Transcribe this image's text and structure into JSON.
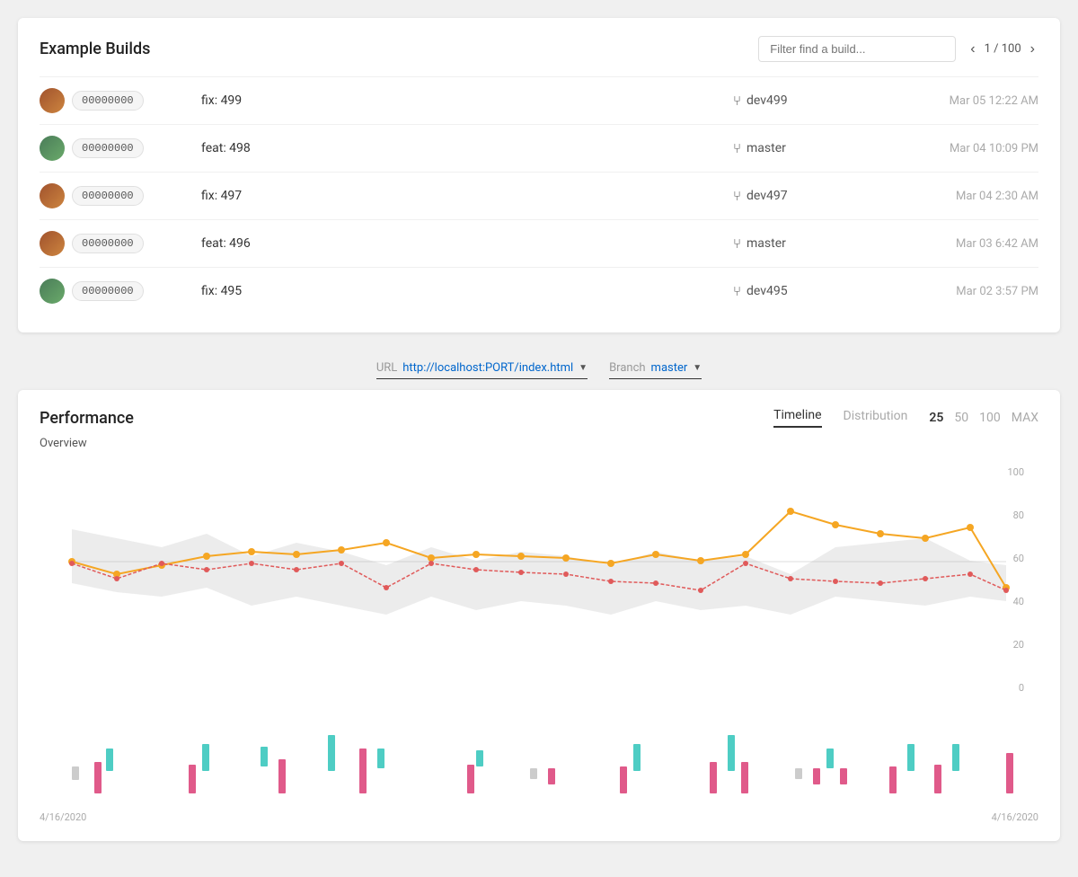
{
  "builds": {
    "title": "Example Builds",
    "filter_placeholder": "Filter find a build...",
    "pagination": {
      "current": "1",
      "total": "100",
      "label": "1 / 100"
    },
    "rows": [
      {
        "id": "00000000",
        "label": "fix: 499",
        "branch": "dev499",
        "date": "Mar 05 12:22 AM",
        "avatar_class": "avatar-1"
      },
      {
        "id": "00000000",
        "label": "feat: 498",
        "branch": "master",
        "date": "Mar 04 10:09 PM",
        "avatar_class": "avatar-2"
      },
      {
        "id": "00000000",
        "label": "fix: 497",
        "branch": "dev497",
        "date": "Mar 04 2:30 AM",
        "avatar_class": "avatar-3"
      },
      {
        "id": "00000000",
        "label": "feat: 496",
        "branch": "master",
        "date": "Mar 03 6:42 AM",
        "avatar_class": "avatar-4"
      },
      {
        "id": "00000000",
        "label": "fix: 495",
        "branch": "dev495",
        "date": "Mar 02 3:57 PM",
        "avatar_class": "avatar-5"
      }
    ]
  },
  "url_bar": {
    "url_label": "URL",
    "url_value": "http://localhost:PORT/index.html",
    "branch_label": "Branch",
    "branch_value": "master"
  },
  "performance": {
    "title": "Performance",
    "tabs": [
      "Timeline",
      "Distribution"
    ],
    "active_tab": "Timeline",
    "counts": [
      "25",
      "50",
      "100",
      "MAX"
    ],
    "active_count": "25",
    "overview_label": "Overview",
    "y_labels": [
      "100",
      "80",
      "60",
      "40",
      "20",
      "0"
    ],
    "date_start": "4/16/2020",
    "date_end": "4/16/2020"
  }
}
